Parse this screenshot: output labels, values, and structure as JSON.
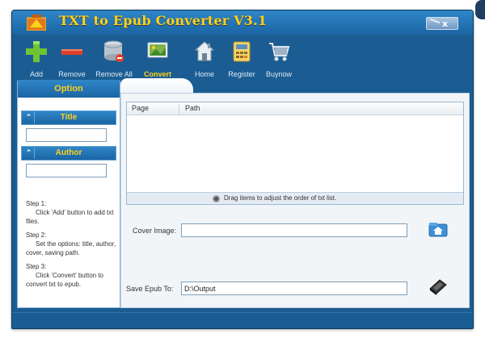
{
  "window": {
    "title": "TXT to Epub Converter V3.1",
    "close_label": "x",
    "colors": {
      "frame": "#1b5d92",
      "title_text": "#ffd21a",
      "panel": "#ffffff"
    }
  },
  "toolbar": {
    "items": [
      {
        "label": "Add",
        "icon": "plus-icon"
      },
      {
        "label": "Remove",
        "icon": "minus-icon"
      },
      {
        "label": "Remove All",
        "icon": "database-remove-icon"
      },
      {
        "label": "Convert",
        "icon": "convert-icon"
      },
      {
        "label": "Home",
        "icon": "home-icon"
      },
      {
        "label": "Register",
        "icon": "register-icon"
      },
      {
        "label": "Buynow",
        "icon": "cart-icon"
      }
    ]
  },
  "option_panel": {
    "header": "Option",
    "title_section": {
      "label": "Title",
      "value": ""
    },
    "author_section": {
      "label": "Author",
      "value": ""
    },
    "steps": [
      {
        "heading": "Step 1:",
        "text": "Click 'Add' button to add txt files."
      },
      {
        "heading": "Step 2:",
        "text": "Set the options: title, author, cover, saving path."
      },
      {
        "heading": "Step 3:",
        "text": "Click 'Convert' button to convert txt to epub."
      }
    ]
  },
  "file_list": {
    "columns": [
      "Page",
      "Path"
    ],
    "rows": [],
    "hint": "Drag items to  adjust the order of txt list."
  },
  "cover_image": {
    "label": "Cover Image:",
    "value": ""
  },
  "save_path": {
    "label": "Save Epub To:",
    "value": "D:\\Output"
  }
}
